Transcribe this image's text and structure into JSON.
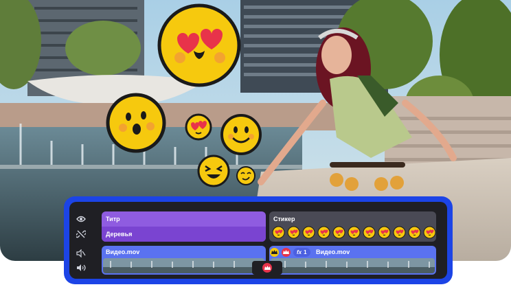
{
  "timeline": {
    "title_clip": {
      "heading": "Титр",
      "text": "Деревья"
    },
    "sticker_clip": {
      "heading": "Стикер",
      "sticker_count": 11
    },
    "video_clips": [
      {
        "label": "Видео.mov"
      },
      {
        "label": "Видео.mov"
      }
    ],
    "effect_badge": {
      "label": "fx",
      "count": "1"
    }
  },
  "icons": {
    "row1": [
      "eye-icon",
      "link-off-icon"
    ],
    "row2": [
      "audio-mute-icon",
      "speaker-icon"
    ]
  },
  "colors": {
    "editor_border": "#1c44e6",
    "title_clip": "#8f5ce0",
    "video_clip": "#5a72f0",
    "sticker_yellow": "#f6c90e"
  }
}
